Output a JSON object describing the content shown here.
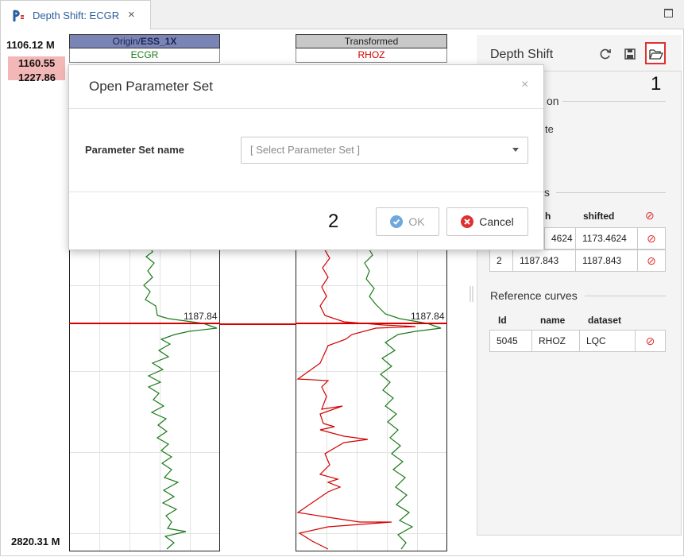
{
  "tab": {
    "title": "Depth Shift: ECGR",
    "close": "×"
  },
  "depth": {
    "top": "1106.12 M",
    "range_start": "1160.55",
    "range_end": "1227.86",
    "bottom": "2820.31 M"
  },
  "track1": {
    "header": "Origin/ESS_1X",
    "header_prefix": "Origin/",
    "header_bold": "ESS_1X",
    "curve": "ECGR",
    "curve_color": "#1a7a1a",
    "header_bg": "#7a84b5",
    "shift_label": "1187.84"
  },
  "track2": {
    "header": "Transformed",
    "curve": "RHOZ",
    "curve_color": "#d50000",
    "header_bg": "#c8c8c8",
    "shift_label": "1187.84"
  },
  "panel": {
    "title": "Depth Shift",
    "refresh_icon": "refresh-icon",
    "save_icon": "save-icon",
    "open_icon": "folder-open-icon",
    "partial_section": "on",
    "partial_text": "te",
    "partial_section2": "s",
    "shift_table": {
      "headers": {
        "idx": "",
        "depth": "h",
        "shifted": "shifted"
      },
      "rows": [
        {
          "idx": "",
          "depth": "4624",
          "shifted": "1173.4624"
        },
        {
          "idx": "2",
          "depth": "1187.843",
          "shifted": "1187.843"
        }
      ]
    },
    "reference_title": "Reference curves",
    "reference_table": {
      "headers": {
        "id": "Id",
        "name": "name",
        "dataset": "dataset"
      },
      "rows": [
        {
          "id": "5045",
          "name": "RHOZ",
          "dataset": "LQC"
        }
      ]
    }
  },
  "callouts": {
    "one": "1",
    "two": "2"
  },
  "dialog": {
    "title": "Open Parameter Set",
    "close": "×",
    "field_label": "Parameter Set name",
    "select_placeholder": "[ Select Parameter Set ]",
    "ok_label": "OK",
    "cancel_label": "Cancel"
  },
  "colors": {
    "accent_blue": "#2a5e9e",
    "danger_red": "#e03131"
  }
}
